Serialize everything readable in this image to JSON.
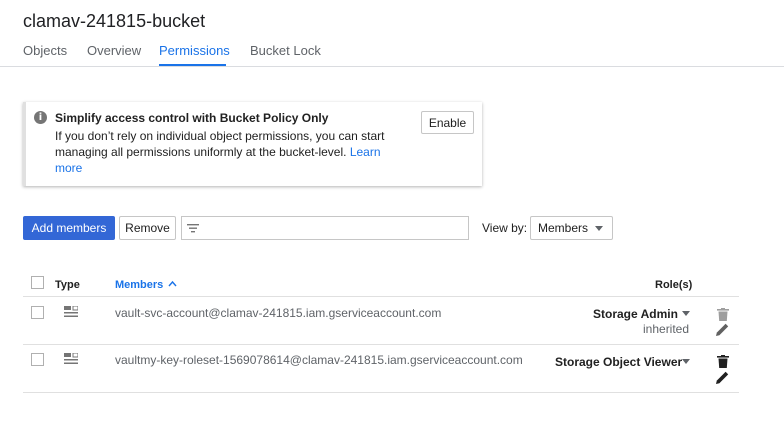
{
  "bucket_title": "clamav-241815-bucket",
  "tabs": [
    {
      "label": "Objects",
      "active": false
    },
    {
      "label": "Overview",
      "active": false
    },
    {
      "label": "Permissions",
      "active": true
    },
    {
      "label": "Bucket Lock",
      "active": false
    }
  ],
  "info_card": {
    "title": "Simplify access control with Bucket Policy Only",
    "body": "If you don’t rely on individual object permissions, you can start managing all permissions uniformly at the bucket-level.",
    "link": "Learn more",
    "enable_label": "Enable"
  },
  "toolbar": {
    "add_members_label": "Add members",
    "remove_label": "Remove",
    "filter_value": "",
    "view_by_label": "View by:",
    "view_by_value": "Members"
  },
  "table": {
    "columns": {
      "type": "Type",
      "members": "Members",
      "roles": "Role(s)"
    },
    "sort": {
      "column": "members",
      "direction": "ascending"
    },
    "rows": [
      {
        "type_icon": "service-account-icon",
        "member": "vault-svc-account@clamav-241815.iam.gserviceaccount.com",
        "role": "Storage Admin",
        "inherited": "inherited",
        "checked": false
      },
      {
        "type_icon": "service-account-icon",
        "member": "vaultmy-key-roleset-1569078614@clamav-241815.iam.gserviceaccount.com",
        "role": "Storage Object Viewer",
        "inherited": "",
        "checked": false
      }
    ]
  },
  "colors": {
    "accent": "#1a73e8",
    "primary_button": "#3367d6",
    "divider": "#e0e0e0",
    "icon_gray": "#757575"
  }
}
